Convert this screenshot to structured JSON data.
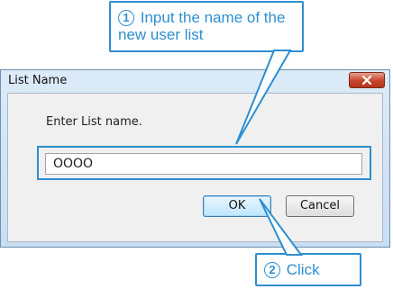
{
  "callouts": [
    {
      "number": "1",
      "text": "Input the name of the new user list"
    },
    {
      "number": "2",
      "text": "Click"
    }
  ],
  "dialog": {
    "title": "List Name",
    "close_icon": "close-icon",
    "prompt": "Enter List name.",
    "name_field_value": "OOOO",
    "ok_label": "OK",
    "cancel_label": "Cancel"
  },
  "colors": {
    "callout": "#2e8fd0",
    "close_button": "#c7432a",
    "dialog_frame": "#c9def1"
  }
}
